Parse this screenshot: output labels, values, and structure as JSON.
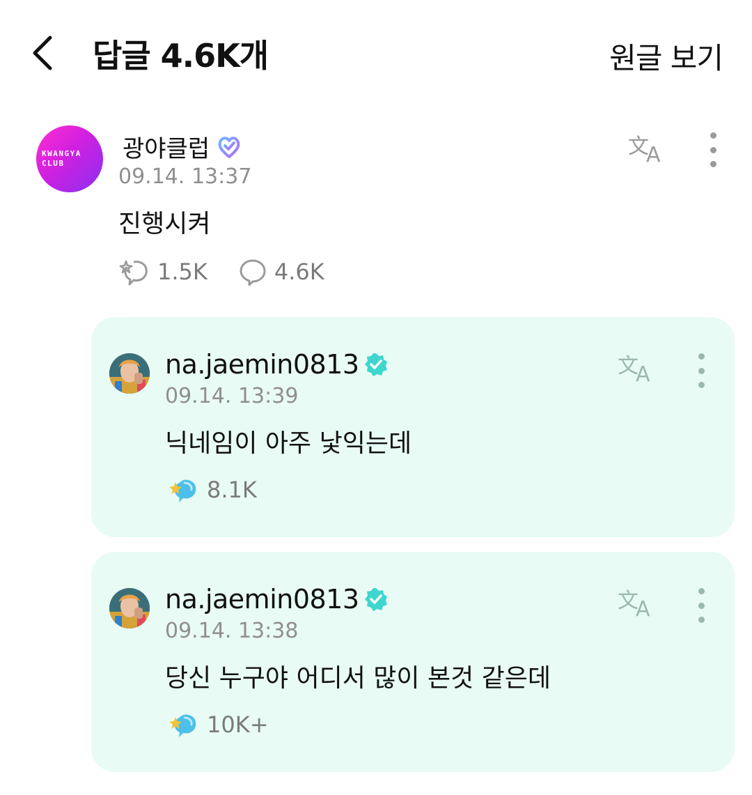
{
  "header": {
    "title": "답글 4.6K개",
    "view_original": "원글 보기"
  },
  "post": {
    "avatar_text_line1": "KWANGYA",
    "avatar_text_line2": "CLUB",
    "author": "광야클럽",
    "time": "09.14. 13:37",
    "body": "진행시켜",
    "reactions": "1.5K",
    "comments": "4.6K"
  },
  "replies": [
    {
      "author": "na.jaemin0813",
      "time": "09.14. 13:39",
      "body": "닉네임이 아주 낯익는데",
      "reactions": "8.1K"
    },
    {
      "author": "na.jaemin0813",
      "time": "09.14. 13:38",
      "body": "당신 누구야 어디서 많이 본것 같은데",
      "reactions": "10K+"
    }
  ],
  "colors": {
    "reply_background": "#e8fbf5",
    "verify_teal": "#3ed6cf",
    "kwangya_gradient_start": "#ff2fd0",
    "kwangya_gradient_end": "#8a2ff0",
    "icon_gray": "#9a9a9a",
    "reply_icon_gray": "#9bb8b0"
  },
  "icons": {
    "back": "chevron-left-icon",
    "translate": "translate-icon",
    "more": "more-vertical-icon",
    "reaction": "sparkle-bubble-icon",
    "comment": "comment-bubble-icon",
    "verify": "verified-badge-icon"
  }
}
